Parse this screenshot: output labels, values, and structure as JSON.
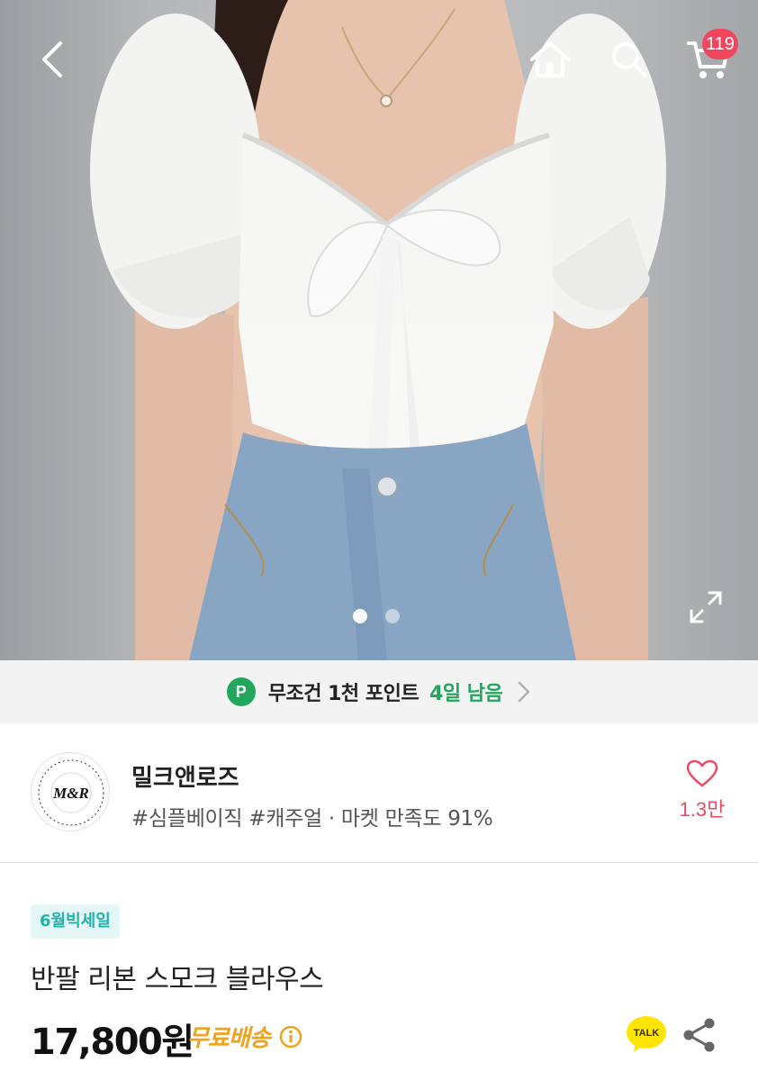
{
  "header": {
    "cart_count": "119",
    "icons": [
      "back-icon",
      "home-icon",
      "search-icon",
      "cart-icon",
      "expand-icon"
    ]
  },
  "gallery": {
    "image_count": 2,
    "active_index": 0
  },
  "point_banner": {
    "badge": "P",
    "text": "무조건 1천 포인트",
    "days_left": "4일 남음"
  },
  "store": {
    "name": "밀크앤로즈",
    "tags": "#심플베이직 #캐주얼 · 마켓 만족도 91%",
    "likes": "1.3만",
    "logo_text": "M&R",
    "logo_ring_text": "CLOTHING STORE MAKES YOU SHINE DAILY"
  },
  "product": {
    "badge": "6월빅세일",
    "title": "반팔 리본 스모크 블라우스",
    "price": "17,800원",
    "shipping": "무료배송",
    "talk_label": "TALK"
  },
  "colors": {
    "cart_badge": "#f1475e",
    "point_green": "#22a65c",
    "like_pink": "#e84d62",
    "sale_teal": "#22b1ad",
    "shipping_orange": "#f0a21f",
    "talk_yellow": "#ffe500"
  }
}
